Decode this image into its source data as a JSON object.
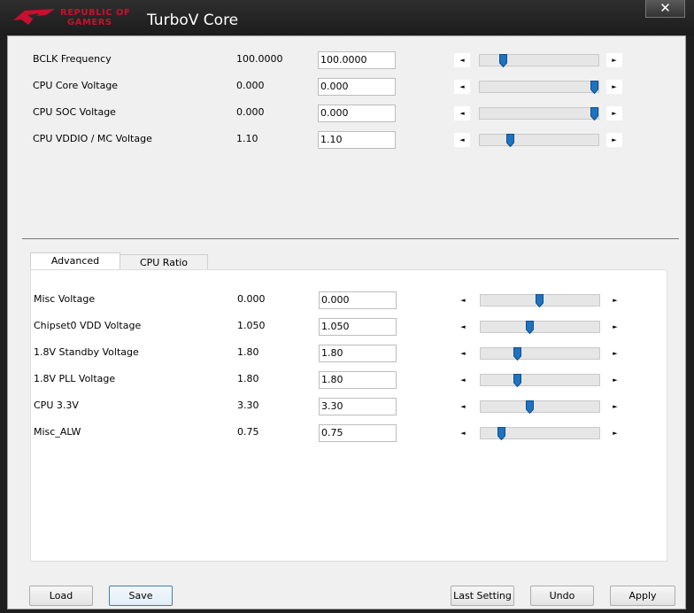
{
  "window": {
    "title": "TurboV Core",
    "logo_line1": "REPUBLIC OF",
    "logo_line2": "GAMERS",
    "close_glyph": "✕",
    "brand_color": "#c8102e"
  },
  "top_settings": [
    {
      "label": "BCLK Frequency",
      "value": "100.0000",
      "input": "100.0000",
      "slider_fraction": 0.2
    },
    {
      "label": "CPU Core Voltage",
      "value": "0.000",
      "input": "0.000",
      "slider_fraction": 0.97
    },
    {
      "label": "CPU SOC Voltage",
      "value": "0.000",
      "input": "0.000",
      "slider_fraction": 0.97
    },
    {
      "label": "CPU VDDIO / MC Voltage",
      "value": "1.10",
      "input": "1.10",
      "slider_fraction": 0.26
    }
  ],
  "tabs": [
    {
      "label": "Advanced",
      "selected": true
    },
    {
      "label": "CPU Ratio",
      "selected": false
    }
  ],
  "advanced_settings": [
    {
      "label": "Misc Voltage",
      "value": "0.000",
      "input": "0.000",
      "slider_fraction": 0.5
    },
    {
      "label": "Chipset0 VDD Voltage",
      "value": "1.050",
      "input": "1.050",
      "slider_fraction": 0.42
    },
    {
      "label": "1.8V Standby Voltage",
      "value": "1.80",
      "input": "1.80",
      "slider_fraction": 0.31
    },
    {
      "label": "1.8V PLL Voltage",
      "value": "1.80",
      "input": "1.80",
      "slider_fraction": 0.31
    },
    {
      "label": "CPU 3.3V",
      "value": "3.30",
      "input": "3.30",
      "slider_fraction": 0.42
    },
    {
      "label": "Misc_ALW",
      "value": "0.75",
      "input": "0.75",
      "slider_fraction": 0.18
    }
  ],
  "arrows": {
    "left": "◄",
    "right": "►"
  },
  "buttons": {
    "load": "Load",
    "save": "Save",
    "last_setting": "Last Setting",
    "undo": "Undo",
    "apply": "Apply"
  },
  "icons": {
    "logo": "rog-eye-logo-icon",
    "close": "close-icon",
    "slider_thumb": "slider-thumb-icon"
  },
  "colors": {
    "thumb": "#1e73be",
    "accent": "#3c7fb1"
  }
}
